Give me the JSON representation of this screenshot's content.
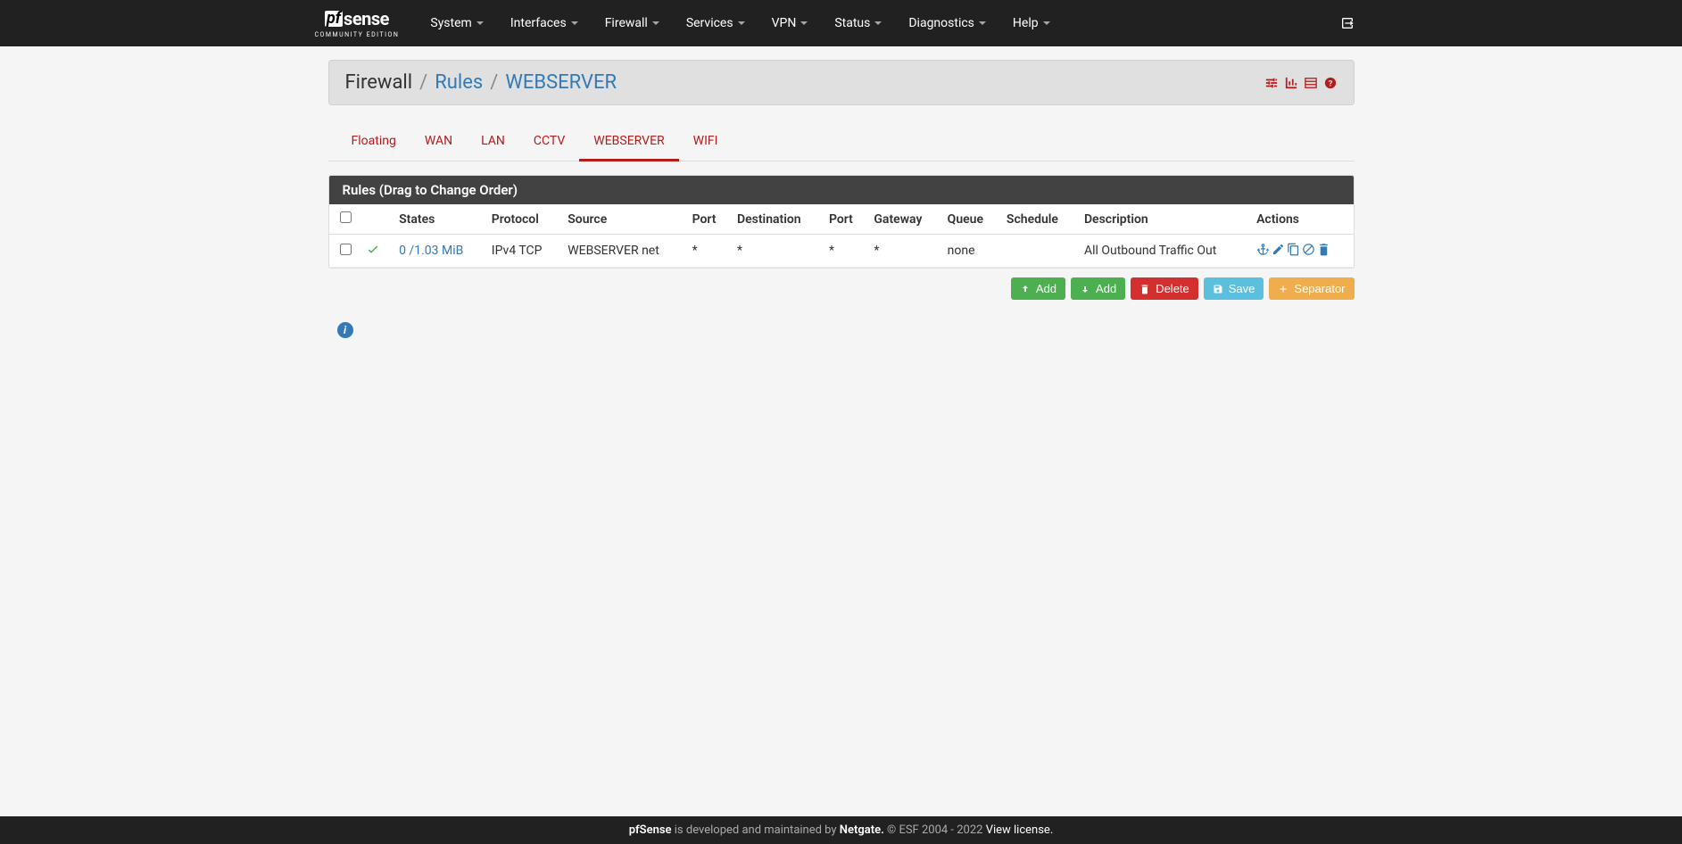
{
  "logo": {
    "prefix": "pf",
    "suffix": "sense",
    "sub": "COMMUNITY EDITION"
  },
  "nav": {
    "items": [
      "System",
      "Interfaces",
      "Firewall",
      "Services",
      "VPN",
      "Status",
      "Diagnostics",
      "Help"
    ]
  },
  "breadcrumb": {
    "root": "Firewall",
    "l1": "Rules",
    "l2": "WEBSERVER"
  },
  "tabs": {
    "items": [
      "Floating",
      "WAN",
      "LAN",
      "CCTV",
      "WEBSERVER",
      "WIFI"
    ],
    "active": "WEBSERVER"
  },
  "panel": {
    "title": "Rules (Drag to Change Order)",
    "columns": [
      "",
      "",
      "States",
      "Protocol",
      "Source",
      "Port",
      "Destination",
      "Port",
      "Gateway",
      "Queue",
      "Schedule",
      "Description",
      "Actions"
    ],
    "rows": [
      {
        "states": "0 /1.03 MiB",
        "protocol": "IPv4 TCP",
        "source": "WEBSERVER net",
        "sport": "*",
        "dest": "*",
        "dport": "*",
        "gateway": "*",
        "queue": "none",
        "schedule": "",
        "description": "All Outbound Traffic Out"
      }
    ]
  },
  "buttons": {
    "add_up": "Add",
    "add_down": "Add",
    "delete": "Delete",
    "save": "Save",
    "separator": "Separator"
  },
  "footer": {
    "brand": "pfSense",
    "text1": " is developed and maintained by ",
    "netgate": "Netgate.",
    "text2": " © ESF 2004 - 2022 ",
    "license": "View license."
  }
}
